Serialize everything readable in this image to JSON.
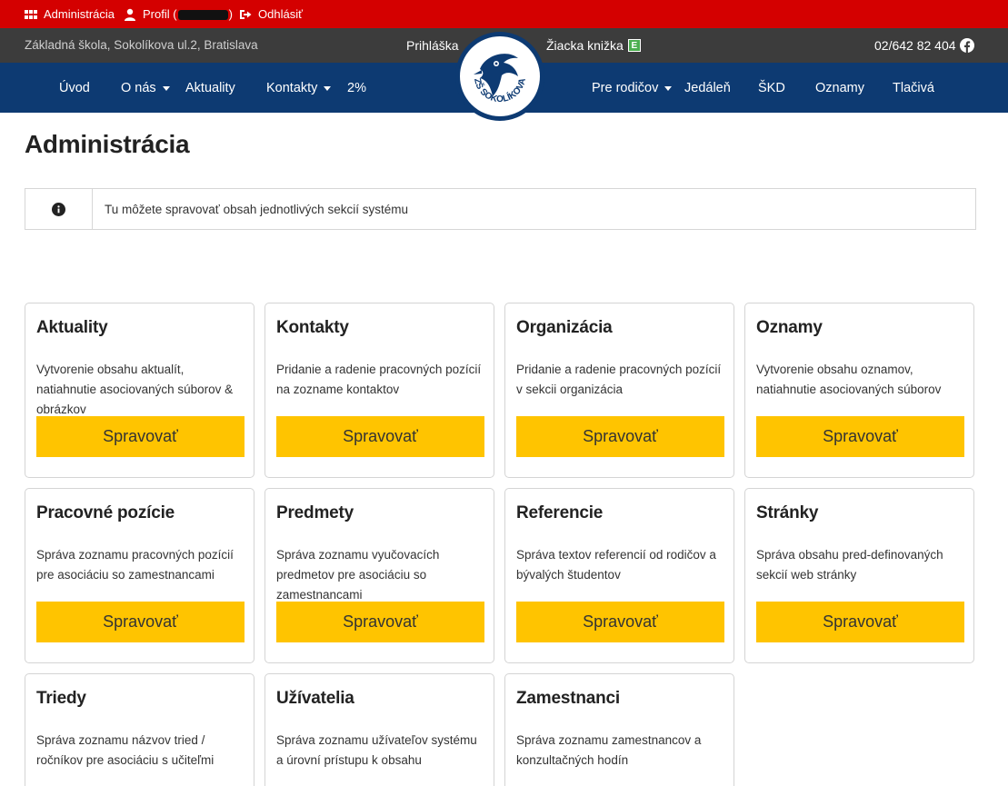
{
  "colors": {
    "admin_bar": "#d40000",
    "info_bar": "#3c3c3c",
    "nav_bar": "#0d3a72",
    "button": "#ffc400"
  },
  "admin_bar": {
    "administracia": "Administrácia",
    "profil_prefix": "Profil (",
    "profil_suffix": ")",
    "odhlasit": "Odhlásiť"
  },
  "info_bar": {
    "school": "Základná škola, Sokolíkova ul.2, Bratislava",
    "prihlaska": "Prihláška",
    "ziacka_knizka": "Žiacka knižka",
    "ziacka_badge": "E",
    "phone": "02/642 82 404",
    "facebook_icon": "facebook-icon"
  },
  "nav": {
    "uvod": "Úvod",
    "o_nas": "O nás",
    "aktuality": "Aktuality",
    "kontakty": "Kontakty",
    "dve_percenta": "2%",
    "pre_rodicov": "Pre rodičov",
    "jedalen": "Jedáleň",
    "skd": "ŠKD",
    "oznamy": "Oznamy",
    "tlaciva": "Tlačivá"
  },
  "logo": {
    "text": "ZŠ SOKOLÍKOVA"
  },
  "page_title": "Administrácia",
  "info_message": "Tu môžete spravovať obsah jednotlivých sekcií systému",
  "cards": [
    {
      "title": "Aktuality",
      "desc": "Vytvorenie obsahu aktualít, natiahnutie asociovaných súborov & obrázkov",
      "button": "Spravovať"
    },
    {
      "title": "Kontakty",
      "desc": "Pridanie a radenie pracovných pozícií na zozname kontaktov",
      "button": "Spravovať"
    },
    {
      "title": "Organizácia",
      "desc": "Pridanie a radenie pracovných pozícií v sekcii organizácia",
      "button": "Spravovať"
    },
    {
      "title": "Oznamy",
      "desc": "Vytvorenie obsahu oznamov, natiahnutie asociovaných súborov",
      "button": "Spravovať"
    },
    {
      "title": "Pracovné pozície",
      "desc": "Správa zoznamu pracovných pozícií pre asociáciu so zamestnancami",
      "button": "Spravovať"
    },
    {
      "title": "Predmety",
      "desc": "Správa zoznamu vyučovacích predmetov pre asociáciu so zamestnancami",
      "button": "Spravovať"
    },
    {
      "title": "Referencie",
      "desc": "Správa textov referencií od rodičov a bývalých študentov",
      "button": "Spravovať"
    },
    {
      "title": "Stránky",
      "desc": "Správa obsahu pred-definovaných sekcií web stránky",
      "button": "Spravovať"
    },
    {
      "title": "Triedy",
      "desc": "Správa zoznamu názvov tried / ročníkov pre asociáciu s učiteľmi",
      "button": ""
    },
    {
      "title": "Užívatelia",
      "desc": "Správa zoznamu užívateľov systému a úrovní prístupu k obsahu",
      "button": ""
    },
    {
      "title": "Zamestnanci",
      "desc": "Správa zoznamu zamestnancov a konzultačných hodín",
      "button": ""
    }
  ]
}
